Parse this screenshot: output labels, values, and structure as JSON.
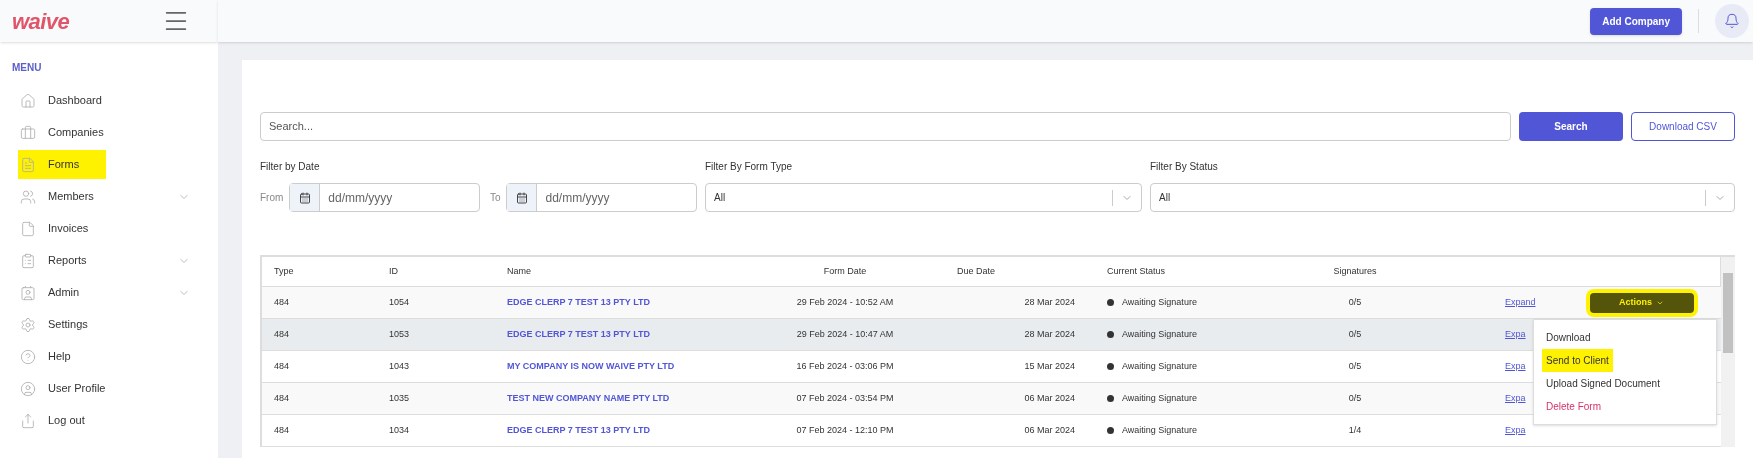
{
  "header": {
    "logo": "waive",
    "add_button": "Add Company"
  },
  "sidebar": {
    "heading": "MENU",
    "items": [
      {
        "label": "Dashboard",
        "has_submenu": false,
        "highlighted": false
      },
      {
        "label": "Companies",
        "has_submenu": false,
        "highlighted": false
      },
      {
        "label": "Forms",
        "has_submenu": false,
        "highlighted": true
      },
      {
        "label": "Members",
        "has_submenu": true,
        "highlighted": false
      },
      {
        "label": "Invoices",
        "has_submenu": false,
        "highlighted": false
      },
      {
        "label": "Reports",
        "has_submenu": true,
        "highlighted": false
      },
      {
        "label": "Admin",
        "has_submenu": true,
        "highlighted": false
      },
      {
        "label": "Settings",
        "has_submenu": false,
        "highlighted": false
      },
      {
        "label": "Help",
        "has_submenu": false,
        "highlighted": false
      },
      {
        "label": "User Profile",
        "has_submenu": false,
        "highlighted": false
      },
      {
        "label": "Log out",
        "has_submenu": false,
        "highlighted": false
      }
    ]
  },
  "search": {
    "placeholder": "Search...",
    "button": "Search",
    "download": "Download CSV"
  },
  "filters": {
    "date_label": "Filter by Date",
    "from": "From",
    "to": "To",
    "from_placeholder": "dd/mm/yyyy",
    "to_placeholder": "dd/mm/yyyy",
    "type_label": "Filter By Form Type",
    "type_value": "All",
    "status_label": "Filter By Status",
    "status_value": "All"
  },
  "table": {
    "columns": [
      "Type",
      "ID",
      "Name",
      "Form Date",
      "Due Date",
      "Current Status",
      "Signatures"
    ],
    "rows": [
      {
        "type": "484",
        "id": "1054",
        "name": "EDGE CLERP 7 TEST 13 PTY LTD",
        "form_date": "29 Feb 2024 - 10:52 AM",
        "due_date": "28 Mar 2024",
        "status": "Awaiting Signature",
        "signatures": "0/5",
        "expand": "Expand",
        "actions": "Actions",
        "hovered": false
      },
      {
        "type": "484",
        "id": "1053",
        "name": "EDGE CLERP 7 TEST 13 PTY LTD",
        "form_date": "29 Feb 2024 - 10:47 AM",
        "due_date": "28 Mar 2024",
        "status": "Awaiting Signature",
        "signatures": "0/5",
        "expand": "Expa",
        "hovered": true
      },
      {
        "type": "484",
        "id": "1043",
        "name": "MY COMPANY IS NOW WAIVE PTY LTD",
        "form_date": "16 Feb 2024 - 03:06 PM",
        "due_date": "15 Mar 2024",
        "status": "Awaiting Signature",
        "signatures": "0/5",
        "expand": "Expa",
        "hovered": false
      },
      {
        "type": "484",
        "id": "1035",
        "name": "TEST NEW COMPANY NAME PTY LTD",
        "form_date": "07 Feb 2024 - 03:54 PM",
        "due_date": "06 Mar 2024",
        "status": "Awaiting Signature",
        "signatures": "0/5",
        "expand": "Expa",
        "hovered": false
      },
      {
        "type": "484",
        "id": "1034",
        "name": "EDGE CLERP 7 TEST 13 PTY LTD",
        "form_date": "07 Feb 2024 - 12:10 PM",
        "due_date": "06 Mar 2024",
        "status": "Awaiting Signature",
        "signatures": "1/4",
        "expand": "Expa",
        "hovered": false
      }
    ],
    "actions_highlighted": true,
    "menu": [
      {
        "label": "Download",
        "kind": "normal",
        "highlighted": false
      },
      {
        "label": "Send to Client",
        "kind": "normal",
        "highlighted": true
      },
      {
        "label": "Upload Signed Document",
        "kind": "normal",
        "highlighted": false
      },
      {
        "label": "Delete Form",
        "kind": "danger",
        "highlighted": false
      }
    ]
  }
}
